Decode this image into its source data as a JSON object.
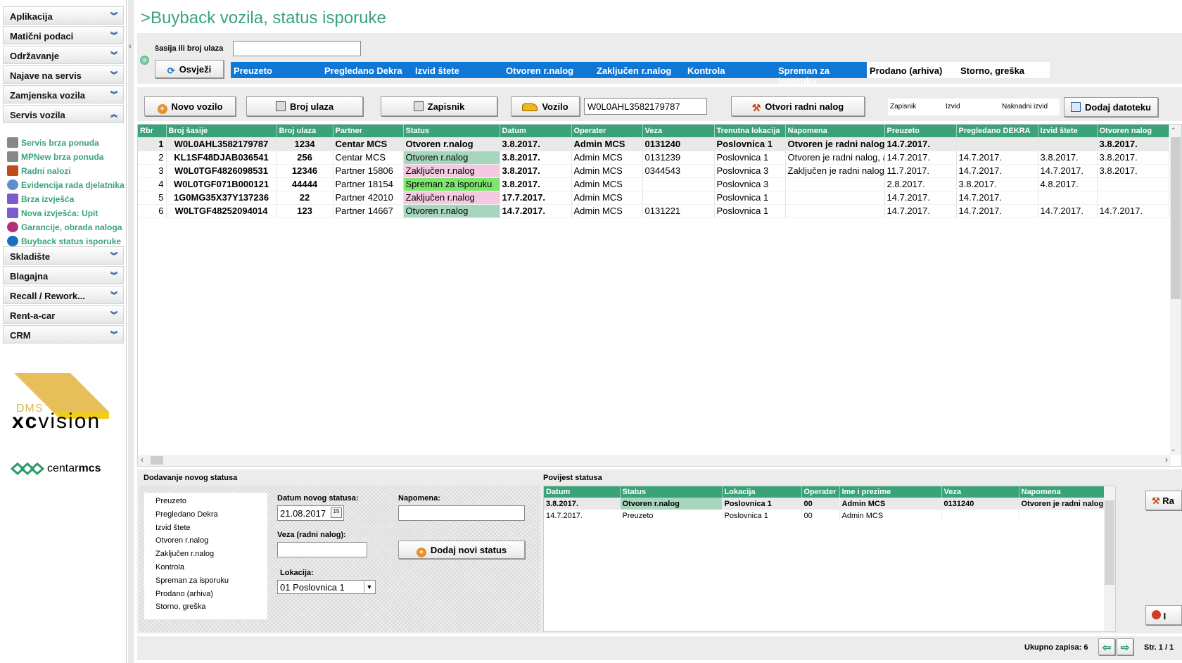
{
  "page": {
    "title": ">Buyback vozila, status isporuke"
  },
  "sidebar": {
    "groups_top": [
      {
        "label": "Aplikacija"
      },
      {
        "label": "Matični podaci"
      },
      {
        "label": "Održavanje"
      },
      {
        "label": "Najave na servis"
      },
      {
        "label": "Zamjenska vozila"
      },
      {
        "label": "Servis vozila"
      }
    ],
    "sub_items": [
      {
        "label": "Servis brza ponuda",
        "icon": "form-icon"
      },
      {
        "label": "MPNew brza ponuda",
        "icon": "form-icon"
      },
      {
        "label": "Radni nalozi",
        "icon": "tools-icon"
      },
      {
        "label": "Evidencija rada djelatnika",
        "icon": "clock-icon"
      },
      {
        "label": "Brza izvješća",
        "icon": "chart-icon"
      },
      {
        "label": "Nova izvješća: Upit",
        "icon": "chart-icon"
      },
      {
        "label": "Garancije, obrada naloga",
        "icon": "check-icon"
      },
      {
        "label": "Buyback status isporuke",
        "icon": "buyback-icon"
      }
    ],
    "groups_bottom": [
      {
        "label": "Skladište"
      },
      {
        "label": "Blagajna"
      },
      {
        "label": "Recall / Rework..."
      },
      {
        "label": "Rent-a-car"
      },
      {
        "label": "CRM"
      }
    ],
    "logo": {
      "dms": "DMS",
      "xc": "xc",
      "vision": "vision",
      "centar": "centar",
      "mcs": "mcs"
    }
  },
  "search": {
    "label": "šasija ili broj ulaza",
    "value": "",
    "refresh": "Osvježi"
  },
  "tabs": [
    "Preuzeto",
    "Pregledano Dekra",
    "Izvid štete",
    "Otvoren r.nalog",
    "Zaključen r.nalog",
    "Kontrola",
    "Spreman za isporuku",
    "Prodano (arhiva)",
    "Storno, greška"
  ],
  "toolbar": {
    "new_vehicle": "Novo vozilo",
    "entry_no": "Broj ulaza",
    "record": "Zapisnik",
    "vehicle": "Vozilo",
    "vehicle_value": "W0L0AHL3582179787",
    "open_order": "Otvori radni nalog",
    "doc_record": "Zapisnik",
    "doc_survey": "Izvid",
    "doc_later": "Naknadni izvid",
    "add_file": "Dodaj datoteku"
  },
  "grid": {
    "columns": [
      "Rbr",
      "Broj šasije",
      "Broj ulaza",
      "Partner",
      "Status",
      "Datum",
      "Operater",
      "Veza",
      "Trenutna lokacija",
      "Napomena",
      "Preuzeto",
      "Pregledano DEKRA",
      "Izvid štete",
      "Otvoren nalog"
    ],
    "rows": [
      [
        "1",
        "W0L0AHL3582179787",
        "1234",
        "Centar MCS",
        "Otvoren r.nalog",
        "3.8.2017.",
        "Admin MCS",
        "0131240",
        "Poslovnica 1",
        "Otvoren je radni nalog",
        "14.7.2017.",
        "",
        "",
        "3.8.2017."
      ],
      [
        "2",
        "KL1SF48DJAB036541",
        "256",
        "Centar MCS",
        "Otvoren r.nalog",
        "3.8.2017.",
        "Admin MCS",
        "0131239",
        "Poslovnica 1",
        "Otvoren je radni nalog, a",
        "14.7.2017.",
        "14.7.2017.",
        "3.8.2017.",
        "3.8.2017."
      ],
      [
        "3",
        "W0L0TGF4826098531",
        "12346",
        "Partner 15806",
        "Zaključen r.nalog",
        "3.8.2017.",
        "Admin MCS",
        "0344543",
        "Poslovnica 3",
        "Zaključen je radni nalog",
        "11.7.2017.",
        "14.7.2017.",
        "14.7.2017.",
        "3.8.2017."
      ],
      [
        "4",
        "W0L0TGF071B000121",
        "44444",
        "Partner 18154",
        "Spreman za isporuku",
        "3.8.2017.",
        "Admin MCS",
        "",
        "Poslovnica 3",
        "",
        "2.8.2017.",
        "3.8.2017.",
        "4.8.2017.",
        ""
      ],
      [
        "5",
        "1G0MG35X37Y137236",
        "22",
        "Partner 42010",
        "Zaključen r.nalog",
        "17.7.2017.",
        "Admin MCS",
        "",
        "Poslovnica 1",
        "",
        "14.7.2017.",
        "14.7.2017.",
        "",
        ""
      ],
      [
        "6",
        "W0LTGF48252094014",
        "123",
        "Partner 14667",
        "Otvoren r.nalog",
        "14.7.2017.",
        "Admin MCS",
        "0131221",
        "Poslovnica 1",
        "",
        "14.7.2017.",
        "14.7.2017.",
        "14.7.2017.",
        "14.7.2017."
      ]
    ]
  },
  "new_status": {
    "header": "Dodavanje novog statusa",
    "statuses": [
      "Preuzeto",
      "Pregledano Dekra",
      "Izvid štete",
      "Otvoren r.nalog",
      "Zaključen r.nalog",
      "Kontrola",
      "Spreman za isporuku",
      "Prodano (arhiva)",
      "Storno, greška"
    ],
    "date_label": "Datum novog statusa:",
    "date_value": "21.08.2017",
    "link_label": "Veza (radni nalog):",
    "location_label": "Lokacija:",
    "location_value": "01 Poslovnica 1",
    "note_label": "Napomena:",
    "add_button": "Dodaj novi status"
  },
  "history": {
    "header": "Povijest statusa",
    "columns": [
      "Datum",
      "Status",
      "Lokacija",
      "Operater",
      "Ime i prezime",
      "Veza",
      "Napomena"
    ],
    "rows": [
      [
        "3.8.2017.",
        "Otvoren r.nalog",
        "Poslovnica 1",
        "00",
        "Admin MCS",
        "0131240",
        "Otvoren je radni nalog, au"
      ],
      [
        "14.7.2017.",
        "Preuzeto",
        "Poslovnica 1",
        "00",
        "Admin MCS",
        "",
        ""
      ]
    ],
    "side_button_1": "Ra",
    "side_button_2": "I"
  },
  "footer": {
    "total_label": "Ukupno zapisa: 6",
    "page_label": "Str. 1 / 1"
  }
}
